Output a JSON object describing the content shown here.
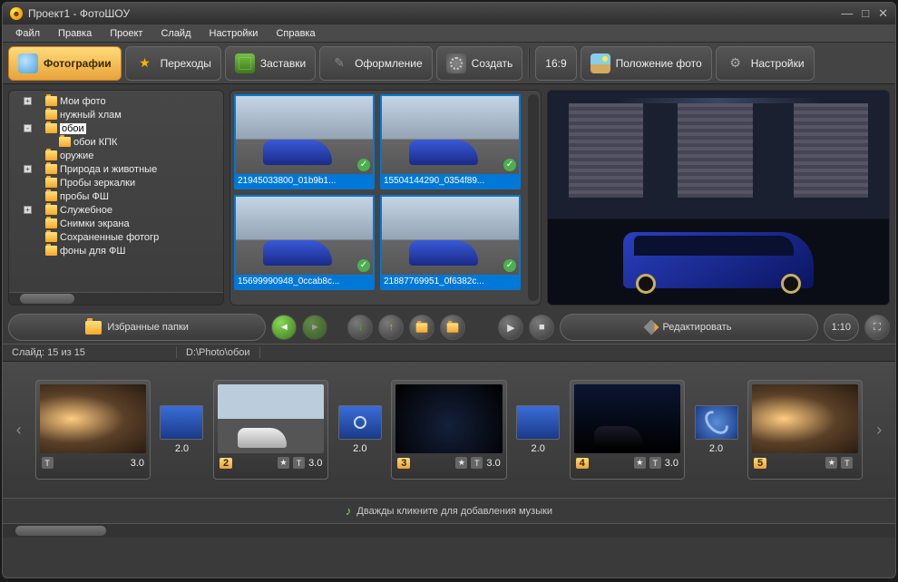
{
  "window": {
    "title": "Проект1 - ФотоШОУ"
  },
  "menu": {
    "file": "Файл",
    "edit": "Правка",
    "project": "Проект",
    "slide": "Слайд",
    "settings": "Настройки",
    "help": "Справка"
  },
  "toolbar": {
    "photos": "Фотографии",
    "transitions": "Переходы",
    "templates": "Заставки",
    "design": "Оформление",
    "create": "Создать",
    "aspect": "16:9",
    "position": "Положение фото",
    "settings": "Настройки"
  },
  "tree": {
    "items": [
      {
        "exp": "+",
        "label": "Мои фото"
      },
      {
        "label": "нужный хлам"
      },
      {
        "exp": "-",
        "label": "обои",
        "sel": true
      },
      {
        "label": "обои КПК",
        "indent": true
      },
      {
        "label": "оружие"
      },
      {
        "exp": "+",
        "label": "Природа и животные"
      },
      {
        "label": "Пробы зеркалки"
      },
      {
        "label": "пробы ФШ"
      },
      {
        "exp": "+",
        "label": "Служебное"
      },
      {
        "label": "Снимки экрана"
      },
      {
        "label": "Сохраненные фотогр"
      },
      {
        "label": "фоны для ФШ"
      }
    ],
    "favorites": "Избранные папки"
  },
  "thumbs": [
    {
      "cap": "21945033800_01b9b1..."
    },
    {
      "cap": "15504144290_0354f89..."
    },
    {
      "cap": "15699990948_0ccab8c..."
    },
    {
      "cap": "21887769951_0f6382c..."
    }
  ],
  "preview": {
    "edit": "Редактировать",
    "time": "1:10"
  },
  "info": {
    "slide": "Слайд: 15 из 15",
    "path": "D:\\Photo\\обои"
  },
  "timeline": {
    "slides": [
      {
        "num": "",
        "dur": "3.0",
        "kind": "fog"
      },
      {
        "num": "2",
        "dur": "3.0",
        "kind": "road"
      },
      {
        "num": "3",
        "dur": "3.0",
        "kind": "dark"
      },
      {
        "num": "4",
        "dur": "3.0",
        "kind": "night"
      },
      {
        "num": "5",
        "dur": "",
        "kind": "fog"
      }
    ],
    "trans": [
      {
        "dur": "2.0",
        "kind": "plain"
      },
      {
        "dur": "2.0",
        "kind": "circle"
      },
      {
        "dur": "2.0",
        "kind": "tiles"
      },
      {
        "dur": "2.0",
        "kind": "swirl"
      }
    ]
  },
  "music": {
    "hint": "Дважды кликните для добавления музыки"
  }
}
